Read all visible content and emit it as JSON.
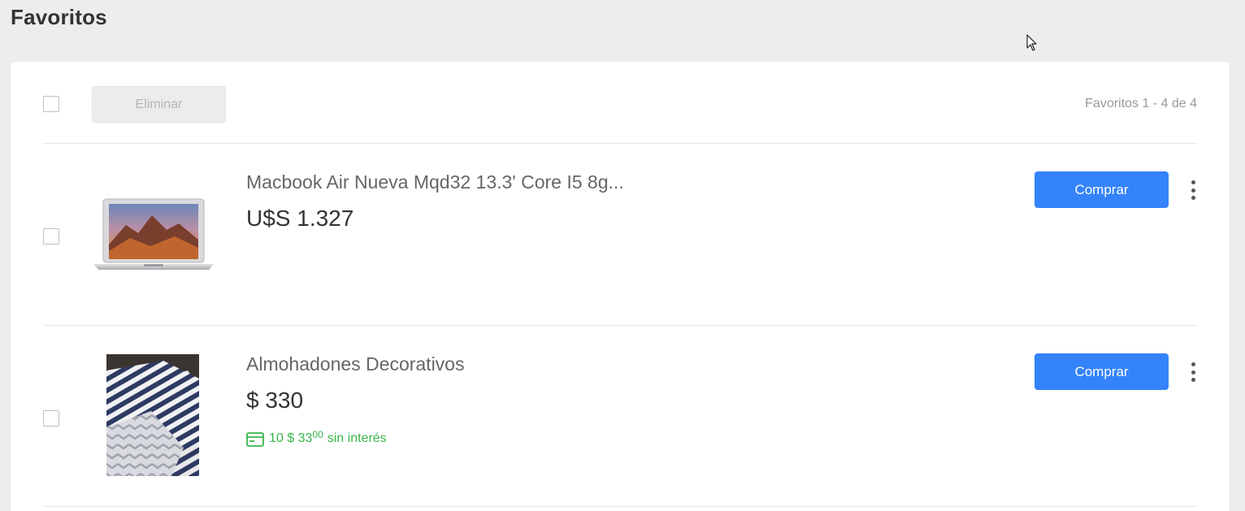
{
  "page": {
    "title": "Favoritos"
  },
  "toolbar": {
    "delete_label": "Eliminar",
    "count_text": "Favoritos 1 - 4 de 4"
  },
  "items": [
    {
      "title": "Macbook Air Nueva Mqd32 13.3' Core I5 8g...",
      "price": "U$S 1.327",
      "buy_label": "Comprar",
      "image": "laptop-image"
    },
    {
      "title": "Almohadones Decorativos",
      "price": "$ 330",
      "installments": {
        "prefix": "10 $ 33",
        "cents": "00",
        "suffix": "sin interés"
      },
      "buy_label": "Comprar",
      "image": "cushions-image"
    }
  ],
  "colors": {
    "accent": "#3483fa",
    "installment_green": "#39b54a",
    "background": "#ededed"
  },
  "icons": [
    "cursor-icon",
    "credit-card-icon",
    "kebab-menu-icon"
  ]
}
